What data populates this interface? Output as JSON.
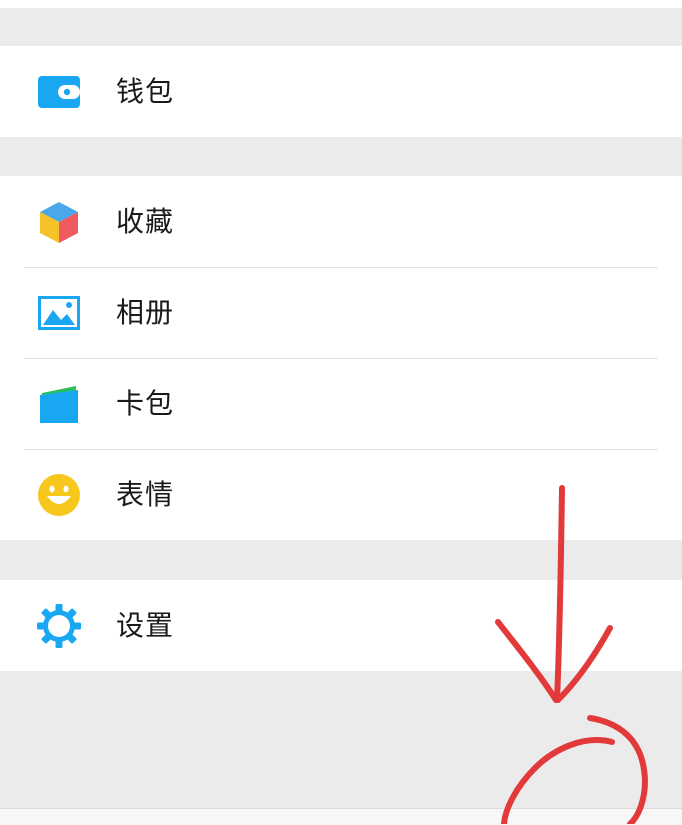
{
  "menu": {
    "wallet": {
      "label": "钱包",
      "icon": "wallet-icon",
      "color": "#1aa7f2"
    },
    "favorites": {
      "label": "收藏",
      "icon": "cube-icon"
    },
    "album": {
      "label": "相册",
      "icon": "picture-icon",
      "color": "#1aa7f2"
    },
    "cards": {
      "label": "卡包",
      "icon": "card-wallet-icon",
      "color": "#1aa7f2"
    },
    "stickers": {
      "label": "表情",
      "icon": "smiley-icon",
      "color": "#f7c71b"
    },
    "settings": {
      "label": "设置",
      "icon": "gear-icon",
      "color": "#1aa7f2"
    }
  },
  "annotation": {
    "color": "#e23a3a",
    "shape": "red-arrow-and-circle"
  }
}
